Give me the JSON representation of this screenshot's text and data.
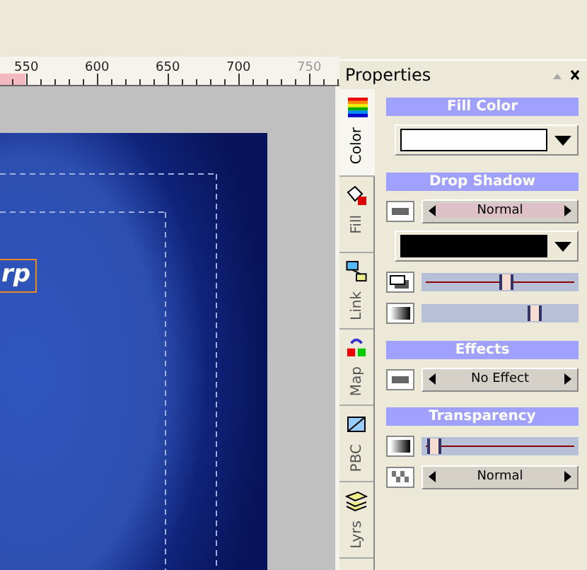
{
  "ruler": {
    "labels": [
      {
        "text": "550",
        "dim": false
      },
      {
        "text": "600",
        "dim": false
      },
      {
        "text": "650",
        "dim": false
      },
      {
        "text": "700",
        "dim": false
      },
      {
        "text": "750",
        "dim": true
      }
    ]
  },
  "canvas": {
    "text_object": {
      "text": "rp",
      "selected": true
    }
  },
  "panel": {
    "title": "Properties",
    "tabs": [
      {
        "label": "Color",
        "selected": true
      },
      {
        "label": "Fill",
        "selected": false
      },
      {
        "label": "Link",
        "selected": false
      },
      {
        "label": "Map",
        "selected": false
      },
      {
        "label": "PBC",
        "selected": false
      },
      {
        "label": "Lyrs",
        "selected": false
      }
    ],
    "sections": [
      {
        "title": "Fill Color",
        "rows": [
          {
            "kind": "color",
            "color": "#ffffff"
          }
        ]
      },
      {
        "title": "Drop Shadow",
        "rows": [
          {
            "kind": "spinner",
            "value": "Normal",
            "color": "#dec0c8"
          },
          {
            "kind": "color",
            "color": "#000000"
          },
          {
            "kind": "line-slider",
            "level": 0.54
          },
          {
            "kind": "slider",
            "level": 0.74
          }
        ]
      },
      {
        "title": "Effects",
        "rows": [
          {
            "kind": "spinner",
            "value": "No Effect",
            "color": "#d4d0c8"
          }
        ]
      },
      {
        "title": "Transparency",
        "rows": [
          {
            "kind": "line-slider",
            "level": 0.04
          },
          {
            "kind": "spinner",
            "value": "Normal",
            "color": "#d4d0c8"
          }
        ]
      }
    ]
  }
}
